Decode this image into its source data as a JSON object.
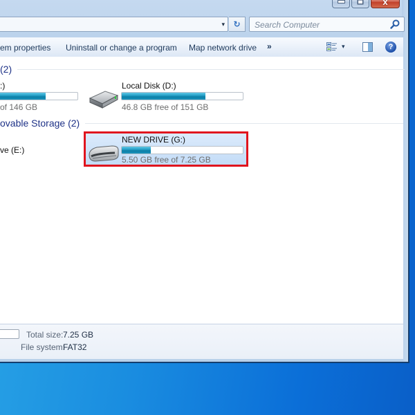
{
  "window": {
    "caption_buttons": {
      "minimize_icon": "minimize-icon",
      "maximize_icon": "maximize-icon",
      "close_label": "x"
    }
  },
  "address_bar": {
    "dropdown_glyph": "▾",
    "refresh_glyph": "↻"
  },
  "search": {
    "placeholder": "Search Computer",
    "icon": "search-icon"
  },
  "command_bar": {
    "items": [
      {
        "label": "em properties"
      },
      {
        "label": "Uninstall or change a program"
      },
      {
        "label": "Map network drive"
      }
    ],
    "more_label": "»",
    "view_dropdown_glyph": "▾",
    "help_label": "?"
  },
  "groups": [
    {
      "title": "(2)",
      "drives": [
        {
          "name": ":)",
          "free_text": "of 146 GB",
          "used_fraction": 0.6
        },
        {
          "name": "Local Disk (D:)",
          "free_text": "46.8 GB free of 151 GB",
          "used_fraction": 0.69
        }
      ]
    },
    {
      "title": "ovable Storage (2)",
      "drives": [
        {
          "name": "ve (E:)"
        },
        {
          "name": "NEW DRIVE (G:)",
          "free_text": "5.50 GB free of 7.25 GB",
          "used_fraction": 0.24,
          "selected": true
        }
      ]
    }
  ],
  "details": {
    "total_size_label": "Total size:",
    "total_size_value": "7.25 GB",
    "file_system_label": "File system:",
    "file_system_value": "FAT32"
  }
}
